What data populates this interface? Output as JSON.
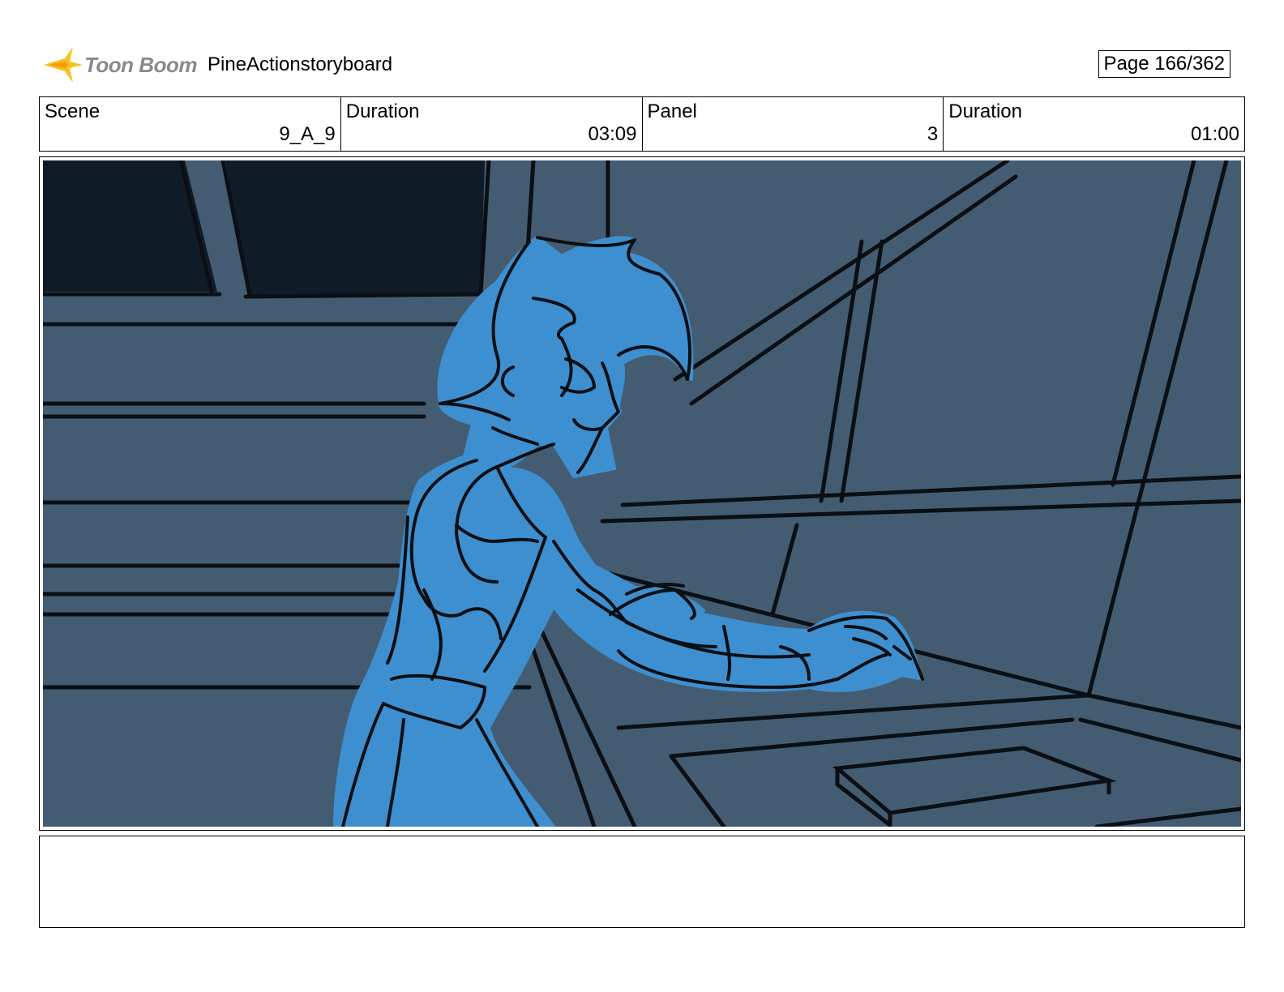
{
  "header": {
    "logo_text": "Toon Boom",
    "project_title": "PineActionstoryboard",
    "page_indicator": "Page 166/362"
  },
  "info": [
    {
      "label": "Scene",
      "value": "9_A_9"
    },
    {
      "label": "Duration",
      "value": "03:09"
    },
    {
      "label": "Panel",
      "value": "3"
    },
    {
      "label": "Duration",
      "value": "01:00"
    }
  ],
  "panel": {
    "image": "storyboard-sketch",
    "background_color": "#445c72",
    "character_color": "#3e8fcf",
    "dark_color": "#0f1c27"
  },
  "notes": ""
}
